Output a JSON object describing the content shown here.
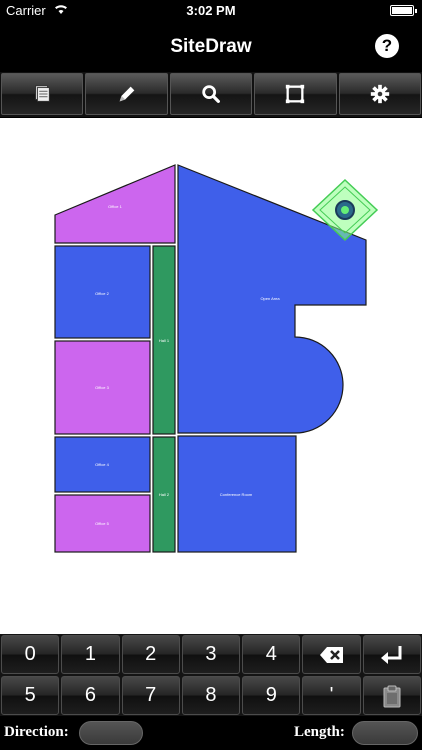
{
  "status": {
    "carrier": "Carrier",
    "time": "3:02 PM"
  },
  "nav": {
    "title": "SiteDraw",
    "help_label": "?"
  },
  "toolbar": {
    "buttons": [
      {
        "icon": "layers-icon"
      },
      {
        "icon": "pencil-icon"
      },
      {
        "icon": "search-icon"
      },
      {
        "icon": "frame-icon"
      },
      {
        "icon": "gear-icon"
      }
    ]
  },
  "plan": {
    "rooms": [
      {
        "label": "Office 1",
        "color": "#cc66ee"
      },
      {
        "label": "Office 2",
        "color": "#3f5fea"
      },
      {
        "label": "Office 3",
        "color": "#cc66ee"
      },
      {
        "label": "Office 4",
        "color": "#3f5fea"
      },
      {
        "label": "Office 5",
        "color": "#cc66ee"
      },
      {
        "label": "Hall 1",
        "color": "#2f9960"
      },
      {
        "label": "Hall 2",
        "color": "#2f9960"
      },
      {
        "label": "Open Area",
        "color": "#3f5fea"
      },
      {
        "label": "Conference Room",
        "color": "#3f5fea"
      }
    ],
    "handle_color": "#66ee77"
  },
  "keypad": {
    "row1": [
      "0",
      "1",
      "2",
      "3",
      "4"
    ],
    "row2": [
      "5",
      "6",
      "7",
      "8",
      "9",
      "'"
    ],
    "backspace_icon": "backspace-icon",
    "enter_icon": "enter-icon",
    "paste_icon": "clipboard-icon"
  },
  "footer": {
    "direction_label": "Direction:",
    "length_label": "Length:",
    "direction_value": "",
    "length_value": ""
  }
}
